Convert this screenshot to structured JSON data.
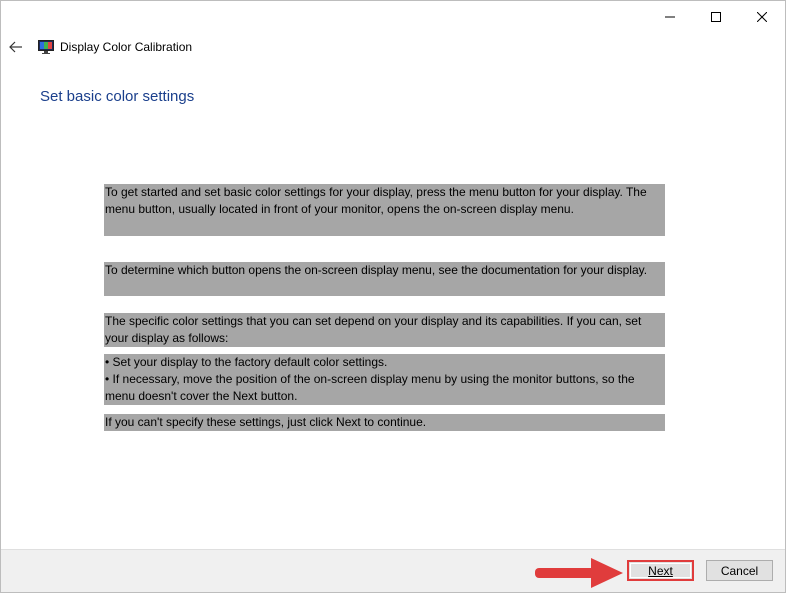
{
  "window": {
    "title": "Display Color Calibration",
    "controls": [
      "minimize",
      "maximize",
      "close"
    ]
  },
  "page": {
    "heading": "Set basic color settings",
    "paragraphs": [
      "To get started and set basic color settings for your display, press the menu button for your display. The menu button, usually located in front of your monitor, opens the on-screen display menu.",
      "To determine which button opens the on-screen display menu, see the documentation for your display.",
      "The specific color settings that you can set depend on your display and its capabilities. If you can, set your display as follows:",
      "• Set your display to the factory default color settings.\n• If necessary, move the position of the on-screen display menu by using the monitor buttons, so the menu doesn't cover the Next button.",
      "If you can't specify these settings,  just click Next to continue."
    ]
  },
  "footer": {
    "next_label": "Next",
    "cancel_label": "Cancel"
  },
  "colors": {
    "heading": "#1a3f8c",
    "highlight": "#a6a6a6",
    "annotation_red": "#e03c3c"
  },
  "icons": {
    "back": "arrow-left-icon",
    "app": "monitor-color-icon",
    "annotation": "red-arrow-icon"
  }
}
